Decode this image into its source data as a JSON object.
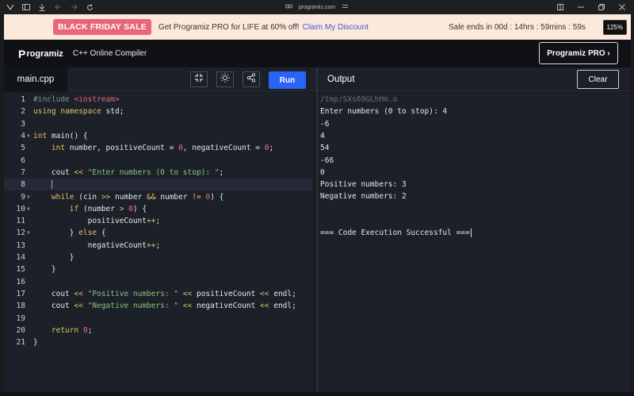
{
  "browser": {
    "url": "programiz.com"
  },
  "banner": {
    "badge": "BLACK FRIDAY SALE",
    "text": "Get Programiz PRO for LIFE at 60% off!",
    "link": "Claim My Discount",
    "countdown": "Sale ends in 00d : 14hrs : 59mins : 59s",
    "zoom": "125%"
  },
  "header": {
    "logo": "rogramiz",
    "logo_p": "P",
    "title": "C++ Online Compiler",
    "pro_button": "Programiz PRO ›"
  },
  "toolbar": {
    "file_tab": "main.cpp",
    "run_label": "Run",
    "output_title": "Output",
    "clear_label": "Clear"
  },
  "editor": {
    "line_numbers": [
      "1",
      "2",
      "3",
      "4",
      "5",
      "6",
      "7",
      "8",
      "9",
      "10",
      "11",
      "12",
      "13",
      "14",
      "15",
      "16",
      "17",
      "18",
      "19",
      "20",
      "21"
    ]
  },
  "output": {
    "lines": [
      "/tmp/SXs69GLhHm.o",
      "Enter numbers (0 to stop): 4",
      "-6",
      "4",
      "54",
      "-66",
      "0",
      "Positive numbers: 3",
      "Negative numbers: 2",
      "",
      "",
      "=== Code Execution Successful ==="
    ]
  }
}
